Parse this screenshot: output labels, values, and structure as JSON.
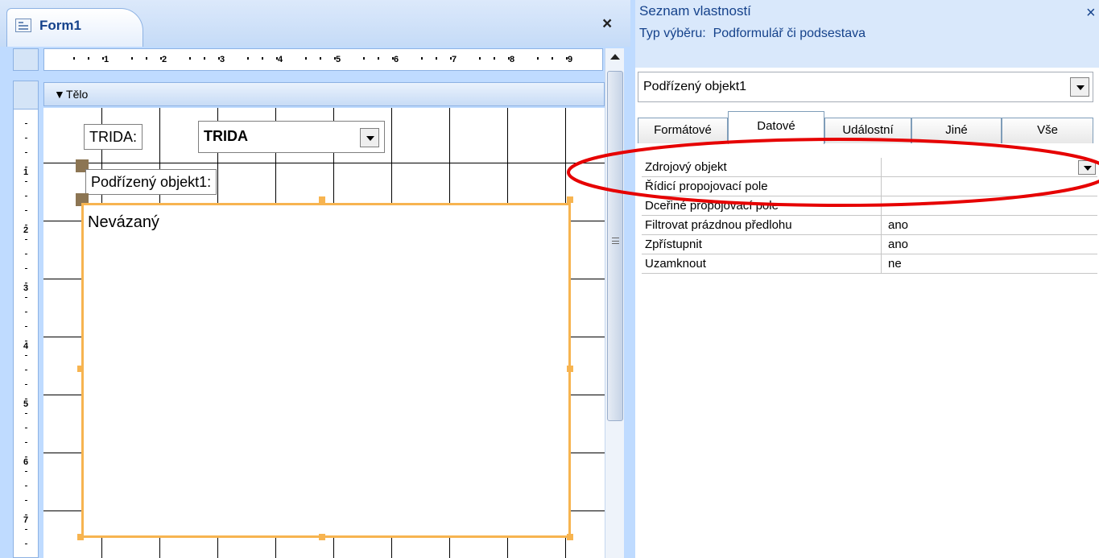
{
  "form_window": {
    "title": "Form1",
    "close_glyph": "×",
    "section_label": "Tělo",
    "h_ruler_numbers": [
      "1",
      "2",
      "3",
      "4",
      "5",
      "6",
      "7",
      "8",
      "9"
    ],
    "v_ruler_numbers": [
      "1",
      "2",
      "3",
      "4",
      "5",
      "6",
      "7"
    ],
    "controls": {
      "trida_label": "TRIDA:",
      "trida_combo_value": "TRIDA",
      "subform_label": "Podřízený objekt1:",
      "subform_text": "Nevázaný"
    }
  },
  "property_sheet": {
    "title": "Seznam vlastností",
    "close_glyph": "×",
    "selection_type_label": "Typ výběru:",
    "selection_type_value": "Podformulář či podsestava",
    "selected_object": "Podřízený objekt1",
    "tabs": [
      {
        "label": "Formátové",
        "active": false
      },
      {
        "label": "Datové",
        "active": true
      },
      {
        "label": "Událostní",
        "active": false
      },
      {
        "label": "Jiné",
        "active": false
      },
      {
        "label": "Vše",
        "active": false
      }
    ],
    "properties": [
      {
        "name": "Zdrojový objekt",
        "value": ""
      },
      {
        "name": "Řídicí propojovací pole",
        "value": ""
      },
      {
        "name": "Dceřiné propojovací pole",
        "value": ""
      },
      {
        "name": "Filtrovat prázdnou předlohu",
        "value": "ano"
      },
      {
        "name": "Zpřístupnit",
        "value": "ano"
      },
      {
        "name": "Uzamknout",
        "value": "ne"
      }
    ]
  },
  "annotation": {
    "color": "#e60000",
    "shape": "ellipse"
  },
  "colors": {
    "selection_border": "#f7b450",
    "header_text": "#15428b"
  }
}
